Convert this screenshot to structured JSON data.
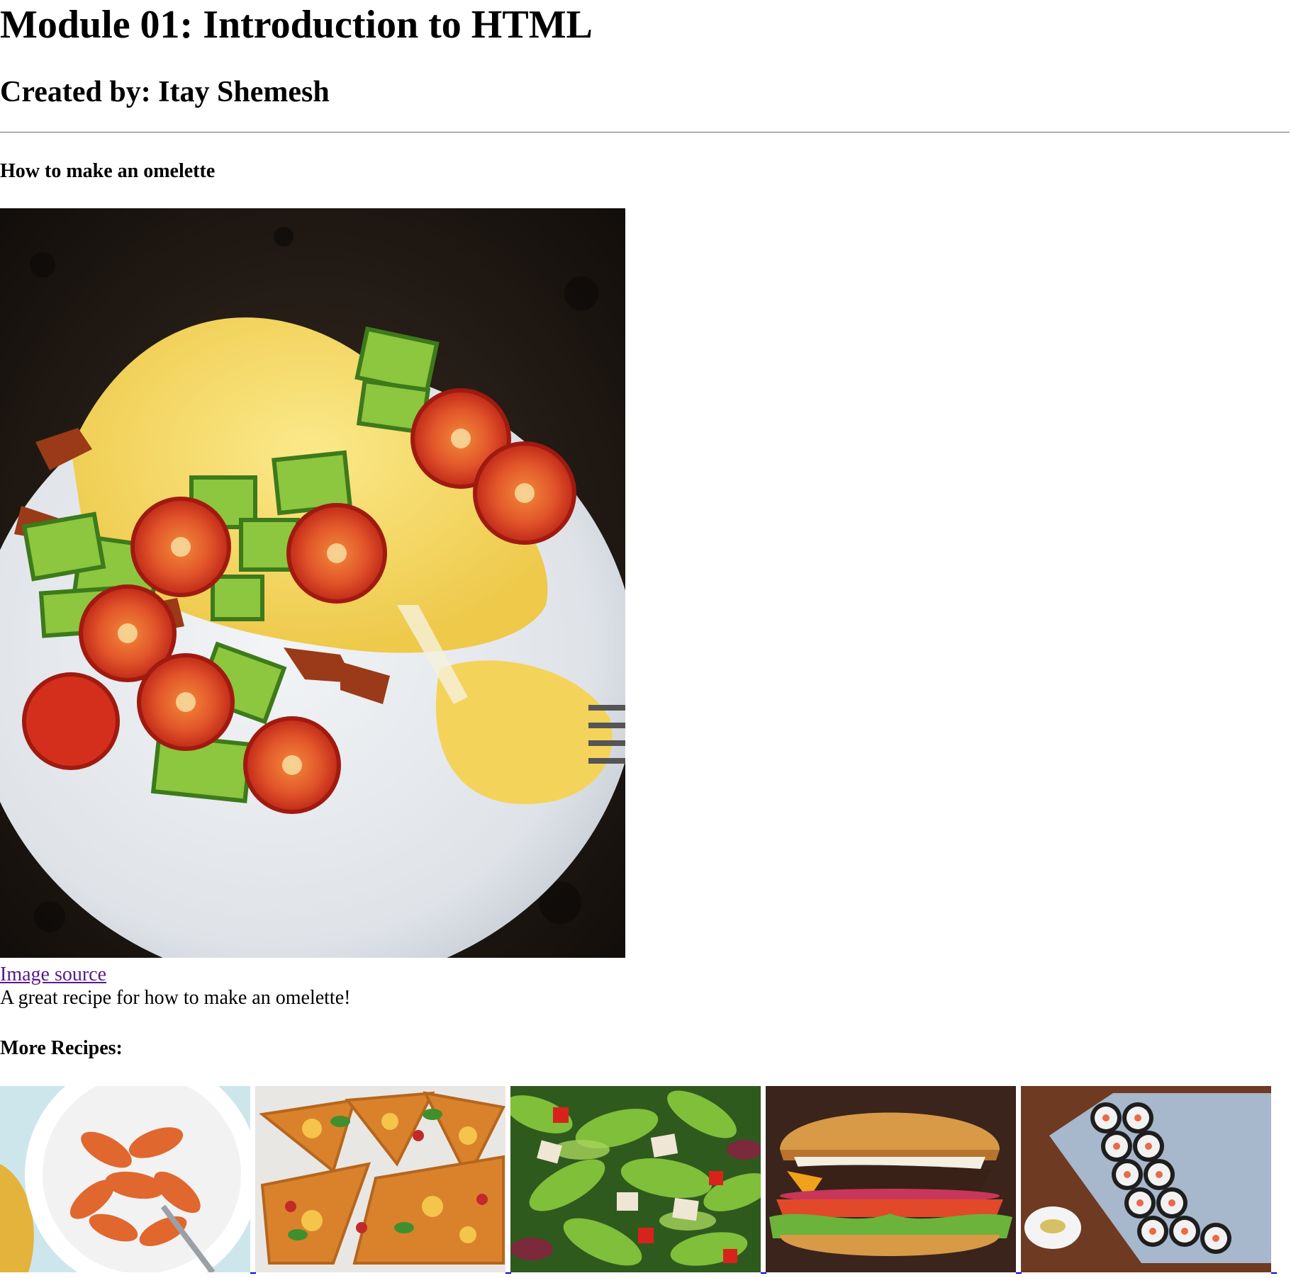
{
  "page": {
    "title": "Module 01: Introduction to HTML",
    "author": "Created by: Itay Shemesh"
  },
  "recipe": {
    "heading": "How to make an omelette",
    "image_alt": "omelette",
    "image_link_label": "Image source",
    "caption": "A great recipe for how to make an omelette!"
  },
  "more": {
    "heading": "More Recipes:",
    "items": [
      {
        "alt": "pasta",
        "icon": "pasta-image"
      },
      {
        "alt": "pizza",
        "icon": "pizza-image"
      },
      {
        "alt": "salad",
        "icon": "salad-image"
      },
      {
        "alt": "burger",
        "icon": "burger-image"
      },
      {
        "alt": "sushi",
        "icon": "sushi-image"
      }
    ]
  },
  "colors": {
    "link_visited": "#551a8b",
    "link": "#0000ee",
    "rule": "#777777"
  }
}
